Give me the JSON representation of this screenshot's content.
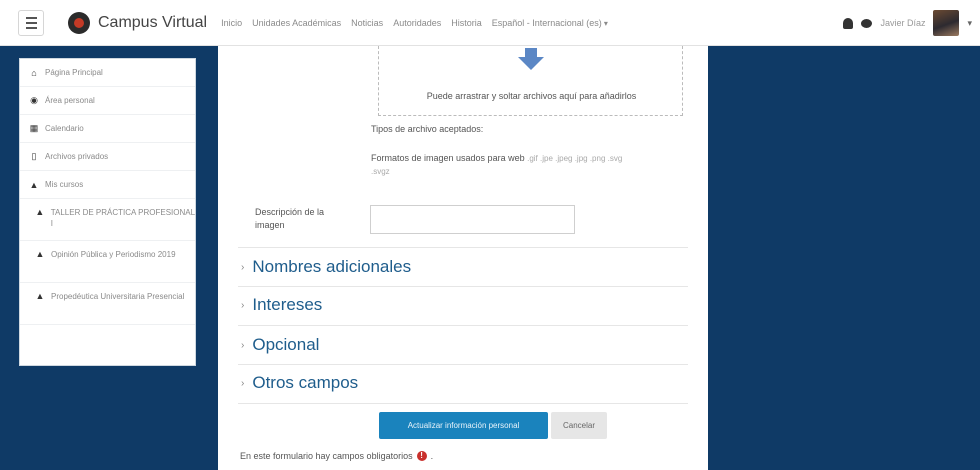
{
  "navbar": {
    "brand": "Campus Virtual",
    "links": [
      "Inicio",
      "Unidades Académicas",
      "Noticias",
      "Autoridades",
      "Historia",
      "Español - Internacional (es)"
    ],
    "lang_caret": "▾",
    "user_name": "Javier Díaz",
    "user_caret": "▾"
  },
  "sidebar": {
    "items": [
      {
        "icon": "home-icon",
        "glyph": "⌂",
        "label": "Página Principal"
      },
      {
        "icon": "dashboard-icon",
        "glyph": "◉",
        "label": "Área personal"
      },
      {
        "icon": "calendar-icon",
        "glyph": "▦",
        "label": "Calendario"
      },
      {
        "icon": "file-icon",
        "glyph": "▯",
        "label": "Archivos privados"
      },
      {
        "icon": "graduation-cap-icon",
        "glyph": "▲",
        "label": "Mis cursos"
      },
      {
        "icon": "graduation-cap-icon",
        "glyph": "▲",
        "label": "TALLER DE PRÁCTICA PROFESIONAL I"
      },
      {
        "icon": "graduation-cap-icon",
        "glyph": "▲",
        "label": "Opinión Pública y Periodismo 2019"
      },
      {
        "icon": "graduation-cap-icon",
        "glyph": "▲",
        "label": "Propedéutica Universitaria Presencial"
      }
    ]
  },
  "form": {
    "dropzone_text": "Puede arrastrar y soltar archivos aquí para añadirlos",
    "accepted_types_label": "Tipos de archivo aceptados:",
    "formats_label": "Formatos de imagen usados para web",
    "formats_ext_1": ".gif .jpe .jpeg .jpg .png .svg",
    "formats_ext_2": ".svgz",
    "description_label": "Descripción de la imagen",
    "description_value": "",
    "sections": [
      "Nombres adicionales",
      "Intereses",
      "Opcional",
      "Otros campos"
    ],
    "submit_label": "Actualizar información personal",
    "cancel_label": "Cancelar",
    "required_note": "En este formulario hay campos obligatorios",
    "required_icon": "!"
  },
  "colors": {
    "page_bg": "#0f3a66",
    "accent": "#1a83bd",
    "section_title": "#1f5d8c",
    "required": "#c9302c"
  }
}
